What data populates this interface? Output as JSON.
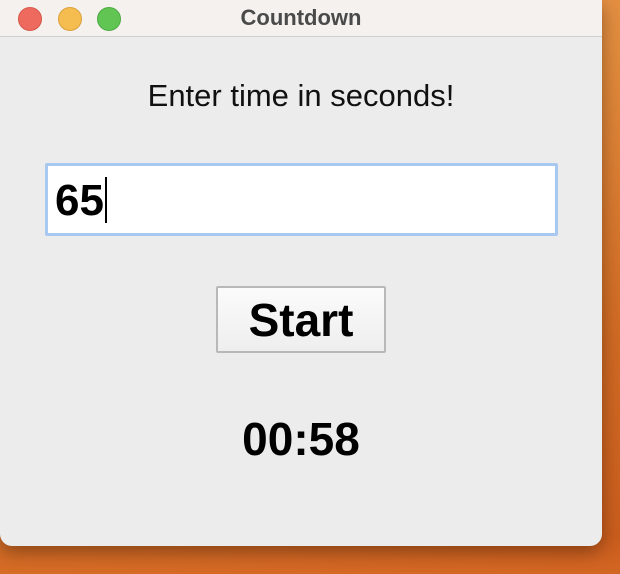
{
  "window": {
    "title": "Countdown"
  },
  "prompt": {
    "text": "Enter time in seconds!"
  },
  "input": {
    "value": "65"
  },
  "start_button": {
    "label": "Start"
  },
  "countdown": {
    "display": "00:58"
  },
  "colors": {
    "close": "#ee6a5e",
    "minimize": "#f5bd4f",
    "maximize": "#61c554",
    "input_focus_border": "#a9c8ef",
    "window_bg": "#ececec"
  }
}
